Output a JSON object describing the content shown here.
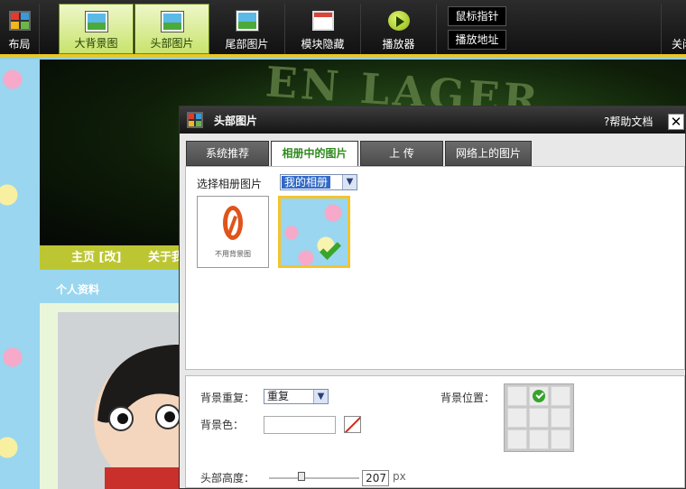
{
  "toolbar": {
    "items": [
      {
        "label": "布局"
      },
      {
        "label": "大背景图"
      },
      {
        "label": "头部图片"
      },
      {
        "label": "尾部图片"
      },
      {
        "label": "模块隐藏"
      },
      {
        "label": "播放器"
      }
    ],
    "mouse_pointer_label": "鼠标指针",
    "play_address_label": "播放地址",
    "close_label": "关闭",
    "accent_color": "#f0c61a"
  },
  "blog": {
    "header_brand_text": "EN LAGER",
    "nav": {
      "home": "主页 [改]",
      "about": "关于我"
    },
    "section_title": "个人资料"
  },
  "dialog": {
    "title": "头部图片",
    "help_label": "?帮助文档",
    "close_glyph": "✕",
    "tabs": [
      {
        "label": "系统推荐",
        "active": false
      },
      {
        "label": "相册中的图片",
        "active": true
      },
      {
        "label": "上  传",
        "active": false
      },
      {
        "label": "网络上的图片",
        "active": false
      }
    ],
    "album": {
      "label": "选择相册图片",
      "selected": "我的相册",
      "thumbs": [
        {
          "caption": "不用背景图",
          "selected": false
        },
        {
          "caption": "",
          "selected": true
        }
      ]
    },
    "settings": {
      "repeat_label": "背景重复：",
      "repeat_value": "重复",
      "color_label": "背景色：",
      "color_value": "",
      "position_label": "背景位置：",
      "position_selected": "top-center",
      "height_label": "头部高度：",
      "height_value": "207",
      "height_unit": "px",
      "height_slider_fraction": 0.35
    }
  }
}
